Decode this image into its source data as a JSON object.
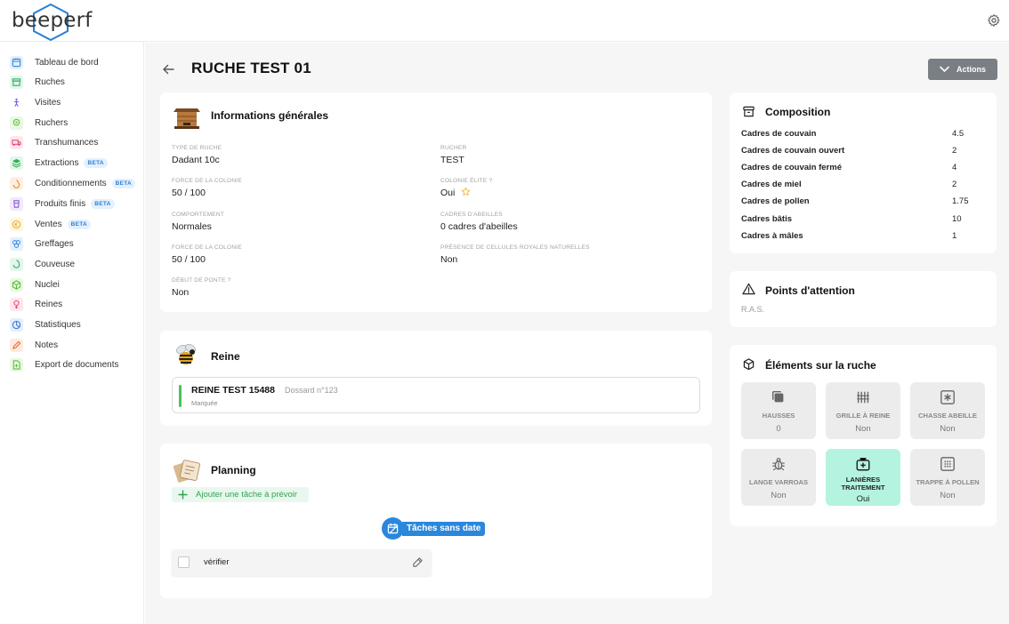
{
  "app": {
    "logo_text": "beeperf"
  },
  "sidebar": {
    "items": [
      {
        "label": "Tableau de bord",
        "beta": "",
        "color": "#3a8dde",
        "bg": "#e5f0fb"
      },
      {
        "label": "Ruches",
        "beta": "",
        "color": "#2fae6b",
        "bg": "#e3f6ec"
      },
      {
        "label": "Visites",
        "beta": "",
        "color": "#6c5ce7",
        "bg": "#ffffff"
      },
      {
        "label": "Ruchers",
        "beta": "",
        "color": "#5cbf3d",
        "bg": "#e9f8e2"
      },
      {
        "label": "Transhumances",
        "beta": "",
        "color": "#e84a7a",
        "bg": "#fde7ee"
      },
      {
        "label": "Extractions",
        "beta": "BETA",
        "color": "#2fae4f",
        "bg": "#e3f6e8"
      },
      {
        "label": "Conditionnements",
        "beta": "BETA",
        "color": "#f08a24",
        "bg": "#fdf0e2"
      },
      {
        "label": "Produits finis",
        "beta": "BETA",
        "color": "#8a5cd6",
        "bg": "#f1eafb"
      },
      {
        "label": "Ventes",
        "beta": "BETA",
        "color": "#f0b429",
        "bg": "#fdf6e0"
      },
      {
        "label": "Greffages",
        "beta": "",
        "color": "#3a8dde",
        "bg": "#e5f0fb"
      },
      {
        "label": "Couveuse",
        "beta": "",
        "color": "#2fae6b",
        "bg": "#e3f6ec"
      },
      {
        "label": "Nuclei",
        "beta": "",
        "color": "#5cbf3d",
        "bg": "#e9f8e2"
      },
      {
        "label": "Reines",
        "beta": "",
        "color": "#e84a7a",
        "bg": "#fde7ee"
      },
      {
        "label": "Statistiques",
        "beta": "",
        "color": "#3a7bd5",
        "bg": "#e5eefb"
      },
      {
        "label": "Notes",
        "beta": "",
        "color": "#f06a24",
        "bg": "#fdebe2"
      },
      {
        "label": "Export de documents",
        "beta": "",
        "color": "#5cbf3d",
        "bg": "#e9f8e2"
      }
    ]
  },
  "header": {
    "title": "RUCHE TEST 01",
    "actions_label": "Actions"
  },
  "info": {
    "title": "Informations générales",
    "fields": [
      {
        "label": "TYPE DE RUCHE",
        "value": "Dadant 10c"
      },
      {
        "label": "RUCHER",
        "value": "TEST"
      },
      {
        "label": "FORCE DE LA COLONIE",
        "value": "50 / 100"
      },
      {
        "label": "COLONIE ÉLITE ?",
        "value": "Oui"
      },
      {
        "label": "COMPORTEMENT",
        "value": "Normales"
      },
      {
        "label": "CADRES D'ABEILLES",
        "value": "0 cadres d'abeilles"
      },
      {
        "label": "FORCE DE LA COLONIE",
        "value": "50 / 100"
      },
      {
        "label": "PRÉSENCE DE CELLULES ROYALES NATURELLES",
        "value": "Non"
      },
      {
        "label": "DÉBUT DE PONTE ?",
        "value": "Non"
      }
    ]
  },
  "reine": {
    "title": "Reine",
    "name": "REINE TEST 15488",
    "dossard": "Dossard n°123",
    "status": "Marquée"
  },
  "planning": {
    "title": "Planning",
    "add_task": "Ajouter une tâche à prévoir",
    "undated_label": "Tâches sans date",
    "tasks": [
      {
        "label": "vérifier"
      }
    ]
  },
  "composition": {
    "title": "Composition",
    "rows": [
      {
        "label": "Cadres de couvain",
        "value": "4.5"
      },
      {
        "label": "Cadres de couvain ouvert",
        "value": "2"
      },
      {
        "label": "Cadres de couvain fermé",
        "value": "4"
      },
      {
        "label": "Cadres de miel",
        "value": "2"
      },
      {
        "label": "Cadres de pollen",
        "value": "1.75"
      },
      {
        "label": "Cadres bâtis",
        "value": "10"
      },
      {
        "label": "Cadres à mâles",
        "value": "1"
      }
    ]
  },
  "attention": {
    "title": "Points d'attention",
    "text": "R.A.S."
  },
  "elements": {
    "title": "Éléments sur la ruche",
    "tiles": [
      {
        "label": "HAUSSES",
        "label2": "",
        "value": "0",
        "icon": "stack-icon",
        "active": false
      },
      {
        "label": "GRILLE À REINE",
        "label2": "",
        "value": "Non",
        "icon": "grid-icon",
        "active": false
      },
      {
        "label": "CHASSE ABEILLE",
        "label2": "",
        "value": "Non",
        "icon": "asterisk-box-icon",
        "active": false
      },
      {
        "label": "LANGE VARROAS",
        "label2": "",
        "value": "Non",
        "icon": "bug-icon",
        "active": false
      },
      {
        "label": "LANIÈRES",
        "label2": "TRAITEMENT",
        "value": "Oui",
        "icon": "medkit-icon",
        "active": true
      },
      {
        "label": "TRAPPE À POLLEN",
        "label2": "",
        "value": "Non",
        "icon": "dots-grid-icon",
        "active": false
      }
    ]
  }
}
